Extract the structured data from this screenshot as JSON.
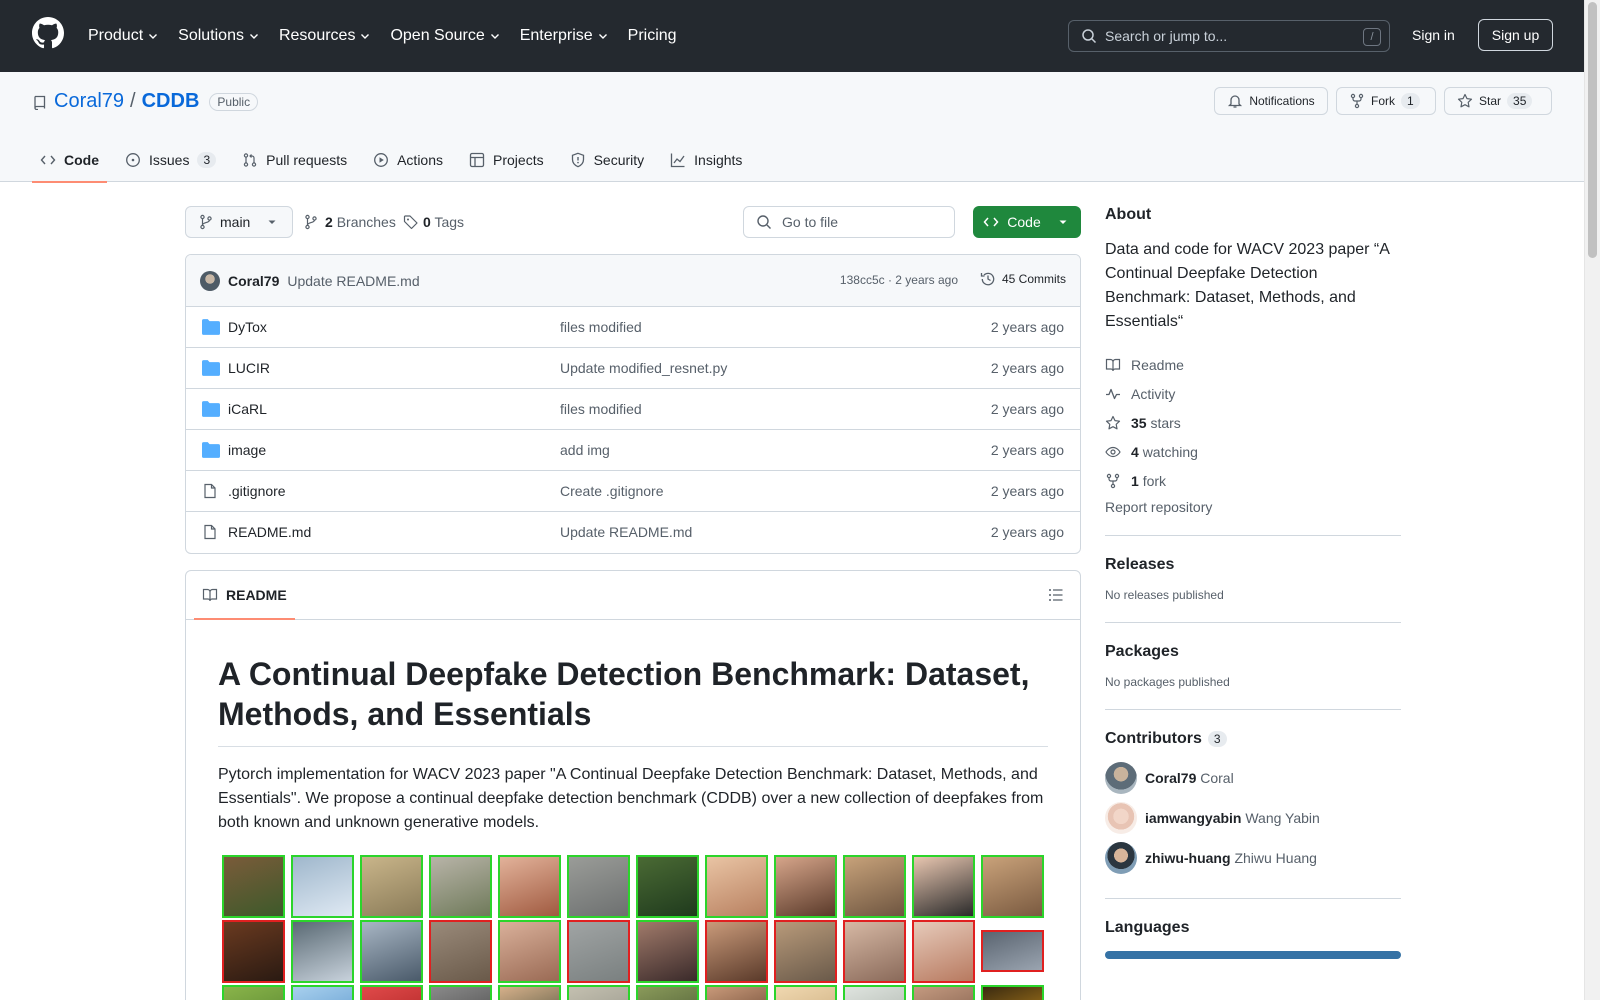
{
  "header": {
    "nav": [
      {
        "label": "Product",
        "dropdown": true
      },
      {
        "label": "Solutions",
        "dropdown": true
      },
      {
        "label": "Resources",
        "dropdown": true
      },
      {
        "label": "Open Source",
        "dropdown": true
      },
      {
        "label": "Enterprise",
        "dropdown": true
      },
      {
        "label": "Pricing",
        "dropdown": false
      }
    ],
    "search_placeholder": "Search or jump to...",
    "search_shortcut": "/",
    "signin": "Sign in",
    "signup": "Sign up"
  },
  "repo": {
    "owner": "Coral79",
    "separator": "/",
    "name": "CDDB",
    "visibility": "Public",
    "actions": {
      "notifications": "Notifications",
      "fork": "Fork",
      "fork_count": "1",
      "star": "Star",
      "star_count": "35"
    },
    "tabs": [
      {
        "label": "Code",
        "icon": "code-icon",
        "counter": ""
      },
      {
        "label": "Issues",
        "icon": "issue-icon",
        "counter": "3"
      },
      {
        "label": "Pull requests",
        "icon": "pull-request-icon",
        "counter": ""
      },
      {
        "label": "Actions",
        "icon": "play-icon",
        "counter": ""
      },
      {
        "label": "Projects",
        "icon": "table-icon",
        "counter": ""
      },
      {
        "label": "Security",
        "icon": "shield-icon",
        "counter": ""
      },
      {
        "label": "Insights",
        "icon": "graph-icon",
        "counter": ""
      }
    ]
  },
  "branch_bar": {
    "branch": "main",
    "branches_count": "2",
    "branches_label": "Branches",
    "tags_count": "0",
    "tags_label": "Tags",
    "goto_placeholder": "Go to file",
    "code_button": "Code"
  },
  "commit": {
    "author": "Coral79",
    "message": "Update README.md",
    "meta": "138cc5c · 2 years ago",
    "commits_label": "45 Commits"
  },
  "files": [
    {
      "type": "folder",
      "name": "DyTox",
      "message": "files modified",
      "age": "2 years ago"
    },
    {
      "type": "folder",
      "name": "LUCIR",
      "message": "Update modified_resnet.py",
      "age": "2 years ago"
    },
    {
      "type": "folder",
      "name": "iCaRL",
      "message": "files modified",
      "age": "2 years ago"
    },
    {
      "type": "folder",
      "name": "image",
      "message": "add img",
      "age": "2 years ago"
    },
    {
      "type": "file",
      "name": ".gitignore",
      "message": "Create .gitignore",
      "age": "2 years ago"
    },
    {
      "type": "file",
      "name": "README.md",
      "message": "Update README.md",
      "age": "2 years ago"
    }
  ],
  "readme": {
    "tab_label": "README",
    "title": "A Continual Deepfake Detection Benchmark: Dataset, Methods, and Essentials",
    "paragraph": "Pytorch implementation for WACV 2023 paper \"A Continual Deepfake Detection Benchmark: Dataset, Methods, and Essentials\". We propose a continual deepfake detection benchmark (CDDB) over a new collection of deepfakes from both known and unknown generative models."
  },
  "sidebar": {
    "about_title": "About",
    "about_description": "Data and code for WACV 2023 paper “A Continual Deepfake Detection Benchmark: Dataset, Methods, and Essentials“",
    "readme": "Readme",
    "activity": "Activity",
    "stars_count": "35",
    "stars_label": "stars",
    "watching_count": "4",
    "watching_label": "watching",
    "fork_count": "1",
    "fork_label": "fork",
    "report": "Report repository",
    "releases_title": "Releases",
    "releases_sub": "No releases published",
    "packages_title": "Packages",
    "packages_sub": "No packages published",
    "contributors_title": "Contributors",
    "contributors_count": "3",
    "contributors": [
      {
        "login": "Coral79",
        "name": "Coral"
      },
      {
        "login": "iamwangyabin",
        "name": "Wang Yabin"
      },
      {
        "login": "zhiwu-huang",
        "name": "Zhiwu Huang"
      }
    ],
    "languages_title": "Languages",
    "language_color": "#3572A5"
  },
  "colors": {
    "header_bg": "#24292f",
    "link": "#0969da",
    "primary_button": "#1f883d",
    "tab_underline": "#fd8c73",
    "real_border": "#2bd52b",
    "fake_border": "#e02020"
  }
}
